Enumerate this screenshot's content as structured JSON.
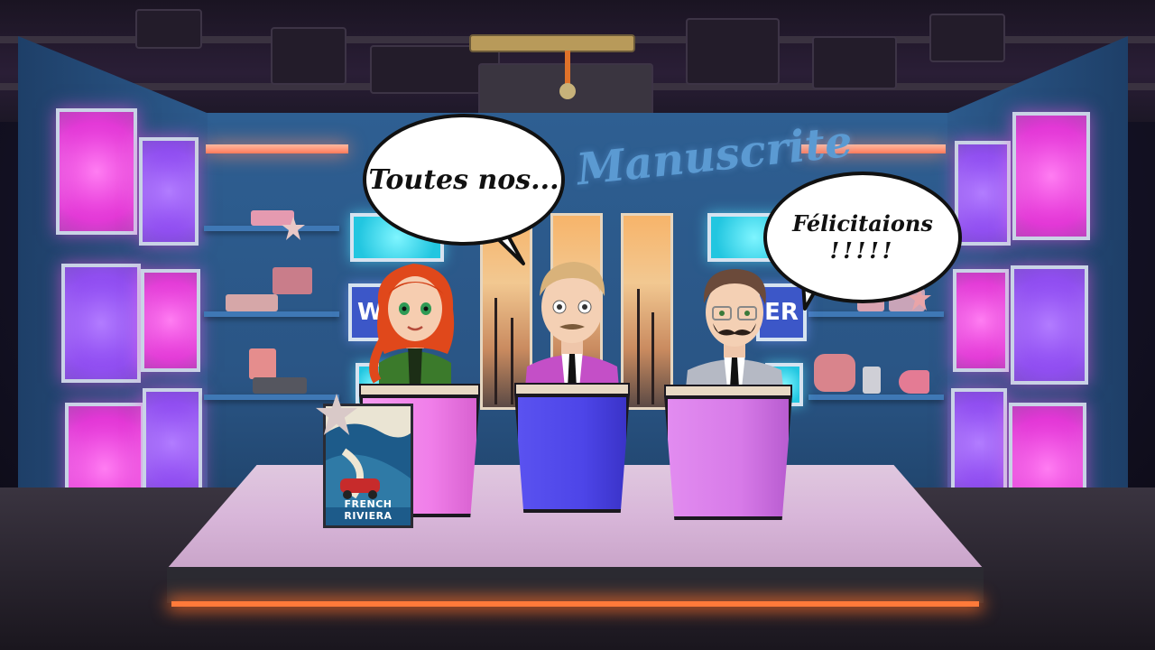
{
  "show": {
    "logo_text": "Manuscrite"
  },
  "bubbles": {
    "left": {
      "text": "Toutes nos..."
    },
    "right": {
      "line1": "Félicitaions",
      "line2": "!!!!!"
    }
  },
  "signs": {
    "left_fragment": "W",
    "right_fragment": "ER"
  },
  "poster": {
    "label": "FRENCH RIVIERA"
  },
  "characters": [
    {
      "name": "redhead-host",
      "hair": "#e0481b",
      "outfit": "#3b7a2b"
    },
    {
      "name": "blond-host",
      "hair": "#d9b27a",
      "outfit": "#c44fc7"
    },
    {
      "name": "brunette-host",
      "hair": "#6b4a3a",
      "outfit": "#b5b9c4"
    }
  ],
  "podiums": [
    {
      "name": "left-podium",
      "color": "#f07ee9"
    },
    {
      "name": "center-podium",
      "color": "#4d45e8"
    },
    {
      "name": "right-podium",
      "color": "#d77ae8"
    }
  ],
  "colors": {
    "panel_pink": "#e22fd5",
    "panel_violet": "#8a44f0",
    "screen_cyan": "#22c6e0",
    "floor_glow": "#ff7a3a"
  }
}
